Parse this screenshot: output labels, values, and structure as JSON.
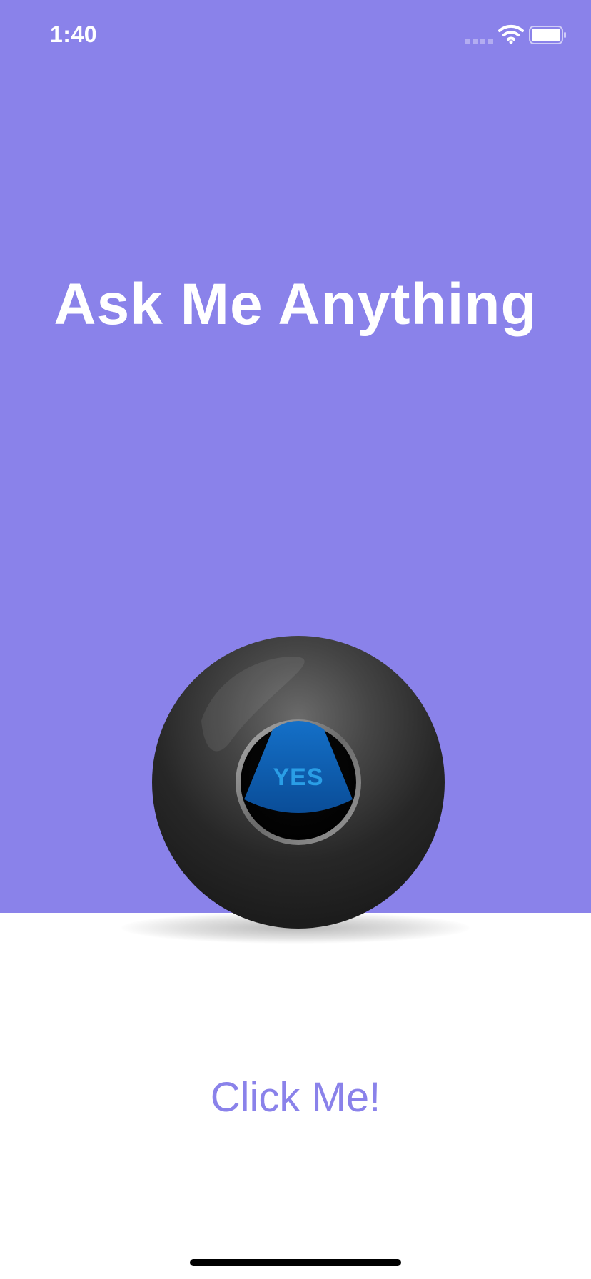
{
  "status_bar": {
    "time": "1:40"
  },
  "main": {
    "title": "Ask Me Anything",
    "ball_answer": "YES",
    "button_label": "Click Me!"
  },
  "colors": {
    "background_top": "#8a82ea",
    "background_bottom": "#ffffff",
    "accent": "#8a82ea",
    "title_text": "#ffffff",
    "answer_text": "#2a9ee6"
  },
  "icons": {
    "signal": "cellular-signal-icon",
    "wifi": "wifi-icon",
    "battery": "battery-icon"
  }
}
